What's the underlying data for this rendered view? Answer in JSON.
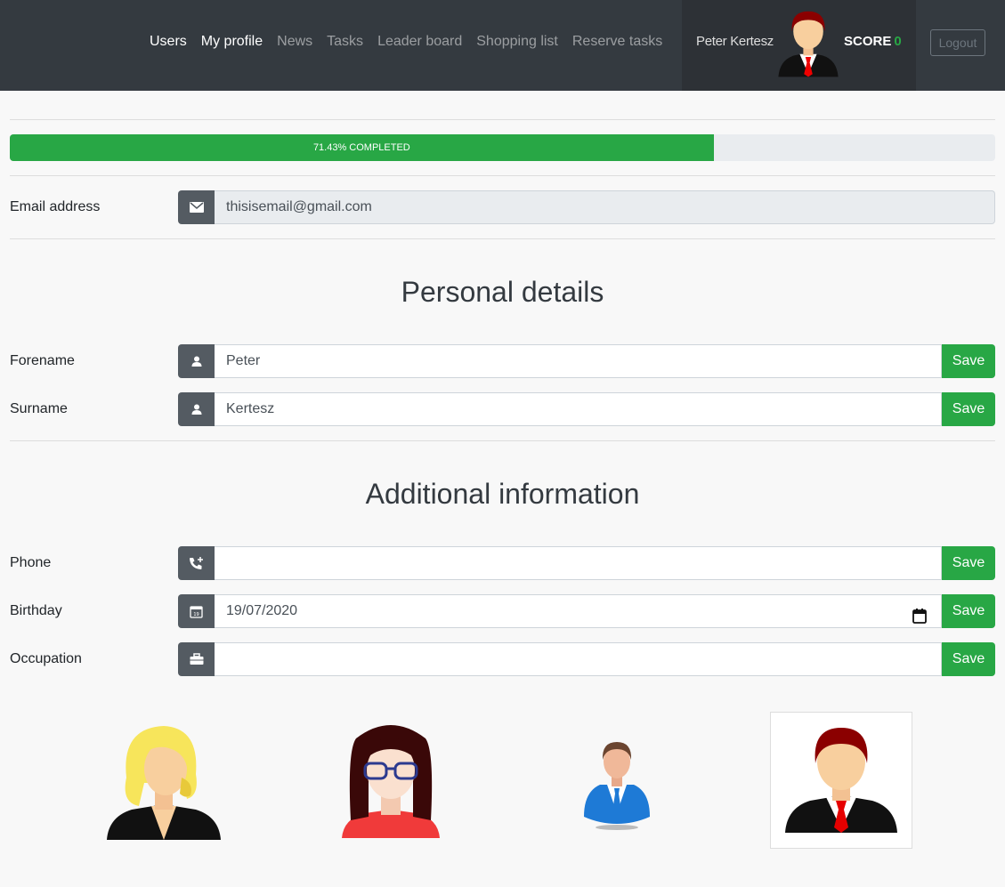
{
  "nav": {
    "links": [
      {
        "label": "Users",
        "active": true
      },
      {
        "label": "My profile",
        "active": true
      },
      {
        "label": "News",
        "active": false
      },
      {
        "label": "Tasks",
        "active": false
      },
      {
        "label": "Leader board",
        "active": false
      },
      {
        "label": "Shopping list",
        "active": false
      },
      {
        "label": "Reserve tasks",
        "active": false
      }
    ],
    "user_name": "Peter Kertesz",
    "score_label": "SCORE",
    "score_value": "0",
    "logout_label": "Logout"
  },
  "progress": {
    "label": "71.43% COMPLETED",
    "fraction": 0.7143
  },
  "email": {
    "label": "Email address",
    "value": "thisisemail@gmail.com",
    "icon": "envelope-icon"
  },
  "personal": {
    "title": "Personal details",
    "forename": {
      "label": "Forename",
      "value": "Peter",
      "icon": "user-icon",
      "save": "Save"
    },
    "surname": {
      "label": "Surname",
      "value": "Kertesz",
      "icon": "user-icon",
      "save": "Save"
    }
  },
  "additional": {
    "title": "Additional information",
    "phone": {
      "label": "Phone",
      "value": "",
      "icon": "phone-plus-icon",
      "save": "Save"
    },
    "birthday": {
      "label": "Birthday",
      "value": "19/07/2020",
      "icon": "calendar-icon",
      "save": "Save"
    },
    "occupation": {
      "label": "Occupation",
      "value": "",
      "icon": "briefcase-icon",
      "save": "Save"
    }
  },
  "avatars": [
    {
      "name": "blonde-woman-avatar",
      "selected": false
    },
    {
      "name": "woman-glasses-avatar",
      "selected": false
    },
    {
      "name": "man-blue-suit-avatar",
      "selected": false
    },
    {
      "name": "man-red-tie-avatar",
      "selected": true
    }
  ],
  "colors": {
    "navbar": "#343a40",
    "success": "#28a745",
    "icon_bg": "#545b62"
  }
}
